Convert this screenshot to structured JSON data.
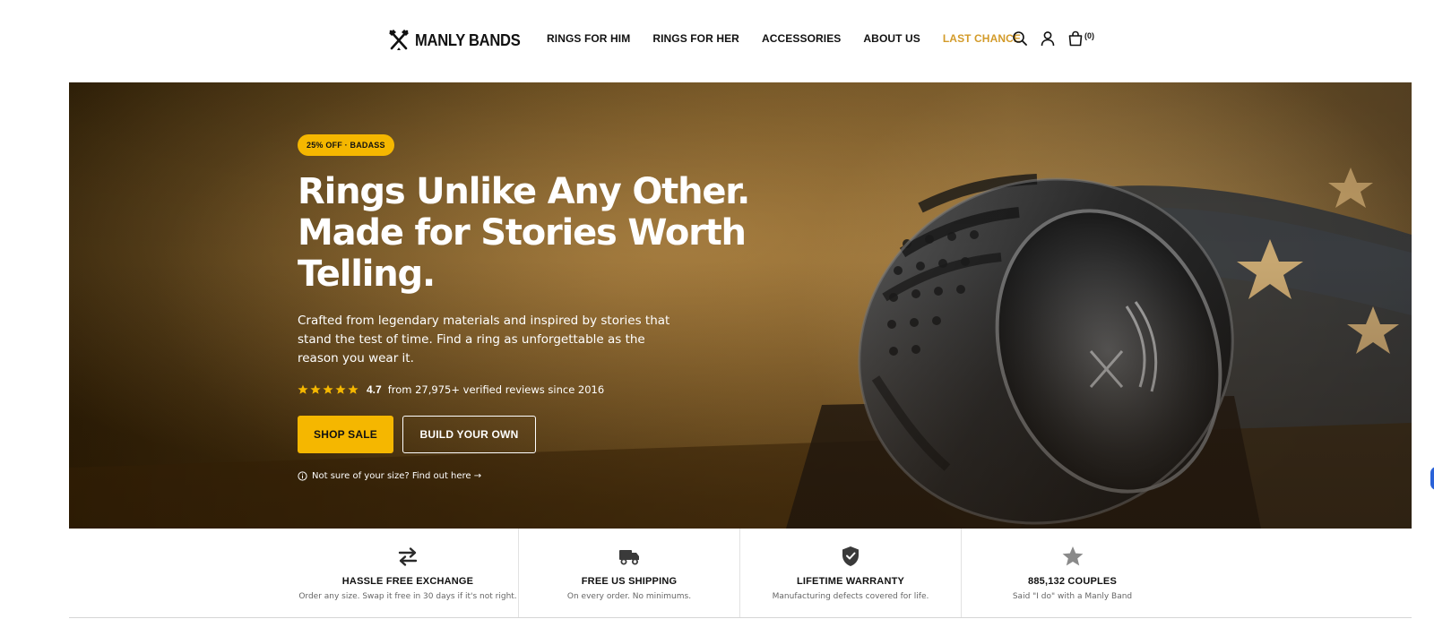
{
  "header": {
    "logo_text": "MANLY BANDS",
    "nav": [
      {
        "label": "RINGS FOR HIM"
      },
      {
        "label": "RINGS FOR HER"
      },
      {
        "label": "ACCESSORIES"
      },
      {
        "label": "ABOUT US"
      },
      {
        "label": "LAST CHANCE",
        "highlight": true
      }
    ],
    "icons": [
      "search-icon",
      "account-icon",
      "cart-icon"
    ],
    "cart_count": "(0)"
  },
  "hero": {
    "badge": "25% OFF · BADASS",
    "title_lines": [
      "Rings Unlike Any Other.",
      "Made for Stories Worth",
      "Telling."
    ],
    "description_lines": [
      "Crafted from legendary materials and inspired by stories that",
      "stand the test of time. Find a ring as unforgettable as the",
      "reason you wear it."
    ],
    "rating": {
      "stars": 5,
      "value": "4.7",
      "text": "from 27,975+ verified reviews since 2016"
    },
    "primary_button": "SHOP SALE",
    "secondary_button": "BUILD YOUR OWN",
    "size_help": "Not sure of your size? Find out here →"
  },
  "features": [
    {
      "icon": "exchange-icon",
      "title": "HASSLE FREE EXCHANGE",
      "text": "Order any size. Swap it free in 30 days if it's not right."
    },
    {
      "icon": "truck-icon",
      "title": "FREE US SHIPPING",
      "text": "On every order. No minimums."
    },
    {
      "icon": "shield-check-icon",
      "title": "LIFETIME WARRANTY",
      "text": "Manufacturing defects covered for life."
    },
    {
      "icon": "star-icon",
      "title": "885,132 COUPLES",
      "text": "Said \"I do\" with a Manly Band"
    }
  ],
  "colors": {
    "accent": "#f5b700",
    "nav_highlight": "#d39b2a",
    "text": "#111111"
  }
}
